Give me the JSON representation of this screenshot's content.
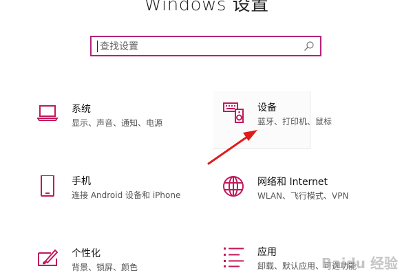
{
  "header": {
    "title": "Windows 设置"
  },
  "search": {
    "placeholder": "查找设置"
  },
  "tiles": [
    {
      "name": "系统",
      "desc": "显示、声音、通知、电源",
      "icon": "laptop-icon"
    },
    {
      "name": "设备",
      "desc": "蓝牙、打印机、鼠标",
      "icon": "keyboard-speaker-icon"
    },
    {
      "name": "手机",
      "desc": "连接 Android 设备和 iPhone",
      "icon": "phone-icon"
    },
    {
      "name": "网络和 Internet",
      "desc": "WLAN、飞行模式、VPN",
      "icon": "globe-icon"
    },
    {
      "name": "个性化",
      "desc": "背景、锁屏、颜色",
      "icon": "paint-brush-icon"
    },
    {
      "name": "应用",
      "desc": "卸载、默认应用、可选功能",
      "icon": "apps-list-icon"
    }
  ],
  "colors": {
    "accent": "#c2185b",
    "arrow": "#e01b1b"
  },
  "watermark": {
    "text": "Baidu 经验"
  }
}
